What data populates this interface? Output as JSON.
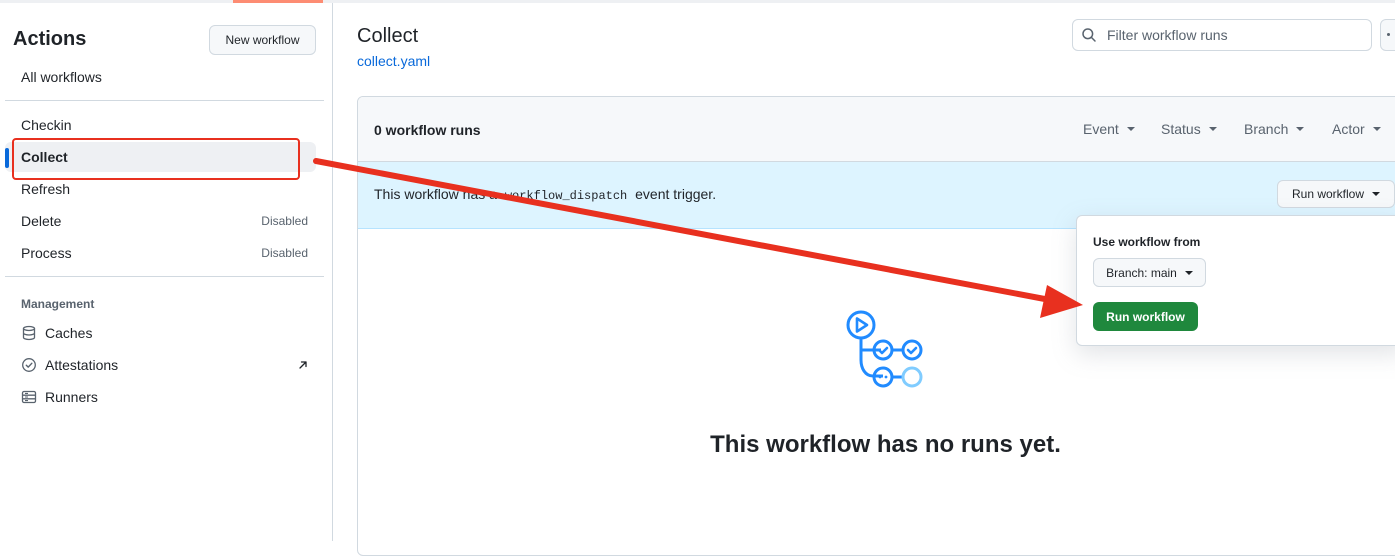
{
  "sidebar": {
    "title": "Actions",
    "new_workflow_label": "New workflow",
    "all_workflows_label": "All workflows",
    "workflows": [
      {
        "label": "Checkin",
        "status": ""
      },
      {
        "label": "Collect",
        "status": "",
        "active": true
      },
      {
        "label": "Refresh",
        "status": ""
      },
      {
        "label": "Delete",
        "status": "Disabled"
      },
      {
        "label": "Process",
        "status": "Disabled"
      }
    ],
    "management_heading": "Management",
    "management_items": [
      {
        "label": "Caches",
        "icon": "database-icon"
      },
      {
        "label": "Attestations",
        "icon": "verified-icon"
      },
      {
        "label": "Runners",
        "icon": "server-icon"
      }
    ]
  },
  "main": {
    "title": "Collect",
    "file_link": "collect.yaml",
    "filter_placeholder": "Filter workflow runs",
    "runs_count": "0 workflow runs",
    "filters": [
      "Event",
      "Status",
      "Branch",
      "Actor"
    ],
    "banner": {
      "prefix": "This workflow has a",
      "code": "workflow_dispatch",
      "suffix": "event trigger."
    },
    "run_workflow_label": "Run workflow",
    "empty_title": "This workflow has no runs yet."
  },
  "popover": {
    "label": "Use workflow from",
    "branch_label": "Branch: main",
    "run_button_label": "Run workflow"
  },
  "colors": {
    "accent": "#0969da",
    "annotation": "#e8301f",
    "primary_button": "#1f883d",
    "banner": "#ddf4ff"
  }
}
